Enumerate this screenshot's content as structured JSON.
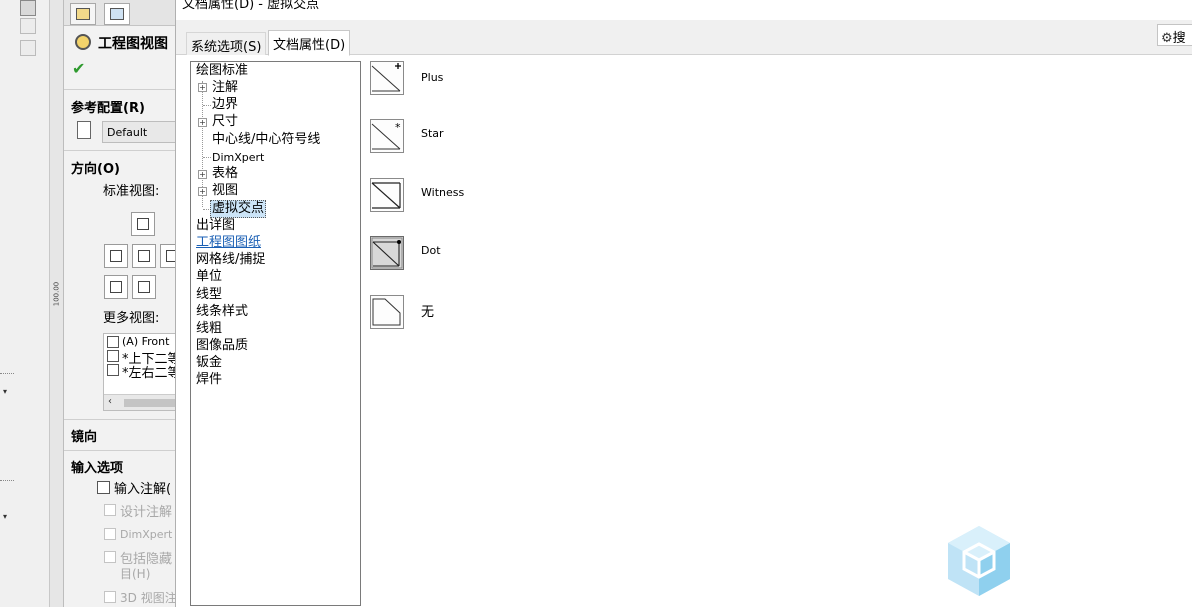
{
  "dialog": {
    "title": "文档属性(D) - 虚拟交点",
    "tabs": [
      {
        "label": "系统选项(S)",
        "active": false
      },
      {
        "label": "文档属性(D)",
        "active": true
      }
    ],
    "search_label": "搜"
  },
  "tree": {
    "items": [
      {
        "label": "绘图标准",
        "level": 0
      },
      {
        "label": "注解",
        "level": 1,
        "expandable": true
      },
      {
        "label": "边界",
        "level": 1
      },
      {
        "label": "尺寸",
        "level": 1,
        "expandable": true
      },
      {
        "label": "中心线/中心符号线",
        "level": 1
      },
      {
        "label": "DimXpert",
        "level": 1
      },
      {
        "label": "表格",
        "level": 1,
        "expandable": true
      },
      {
        "label": "视图",
        "level": 1,
        "expandable": true
      },
      {
        "label": "虚拟交点",
        "level": 1,
        "selected": true
      },
      {
        "label": "出详图",
        "level": 0
      },
      {
        "label": "工程图图纸",
        "level": 0,
        "link": true
      },
      {
        "label": "网格线/捕捉",
        "level": 0
      },
      {
        "label": "单位",
        "level": 0
      },
      {
        "label": "线型",
        "level": 0
      },
      {
        "label": "线条样式",
        "level": 0
      },
      {
        "label": "线粗",
        "level": 0
      },
      {
        "label": "图像品质",
        "level": 0
      },
      {
        "label": "钣金",
        "level": 0
      },
      {
        "label": "焊件",
        "level": 0
      }
    ]
  },
  "options": [
    {
      "label": "Plus",
      "icon": "virtual-sharp-plus-icon",
      "selected": false
    },
    {
      "label": "Star",
      "icon": "virtual-sharp-star-icon",
      "selected": false
    },
    {
      "label": "Witness",
      "icon": "virtual-sharp-witness-icon",
      "selected": false
    },
    {
      "label": "Dot",
      "icon": "virtual-sharp-dot-icon",
      "selected": true
    },
    {
      "label": "无",
      "icon": "virtual-sharp-none-icon",
      "selected": false
    }
  ],
  "property_manager": {
    "title": "工程图视图",
    "ref_config_heading": "参考配置(R)",
    "config_value": "Default",
    "orientation_heading": "方向(O)",
    "standard_views_label": "标准视图:",
    "more_views_label": "更多视图:",
    "more_views": [
      "(A) Front",
      "*上下二等",
      "*左右二等"
    ],
    "mirror_heading": "镜向",
    "import_heading": "输入选项",
    "import_annotations": "输入注解(",
    "design_annotations": "设计注解",
    "dimxpert_annotations": "DimXpert 注",
    "include_hidden_line1": "包括隐藏",
    "include_hidden_line2": "目(H)",
    "view_3d": "3D 视图注"
  },
  "ruler": {
    "label": "100.00"
  },
  "colors": {
    "link": "#1a5fb4",
    "selection": "#cce4f7",
    "ok_check": "#2e9a2e",
    "panel_bg": "#f2f2f2"
  }
}
